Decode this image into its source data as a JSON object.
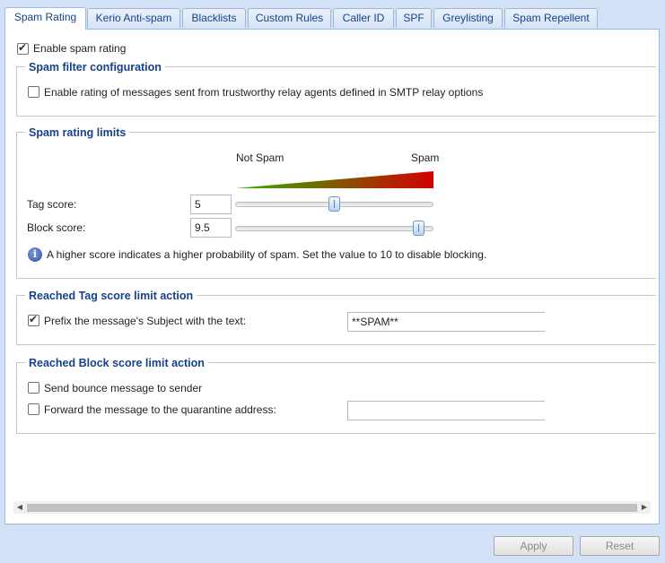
{
  "tabs": [
    {
      "label": "Spam Rating",
      "active": true
    },
    {
      "label": "Kerio Anti-spam"
    },
    {
      "label": "Blacklists"
    },
    {
      "label": "Custom Rules"
    },
    {
      "label": "Caller ID"
    },
    {
      "label": "SPF"
    },
    {
      "label": "Greylisting"
    },
    {
      "label": "Spam Repellent"
    }
  ],
  "enable": {
    "label": "Enable spam rating",
    "checked": true
  },
  "filter_config": {
    "legend": "Spam filter configuration",
    "trustworthy_label": "Enable rating of messages sent from trustworthy relay agents defined in SMTP relay options",
    "trustworthy_checked": false
  },
  "limits": {
    "legend": "Spam rating limits",
    "not_spam_label": "Not Spam",
    "spam_label": "Spam",
    "gradient_colors": [
      "#2db300",
      "#d40000"
    ],
    "tag_label": "Tag score:",
    "tag_value": "5",
    "block_label": "Block score:",
    "block_value": "9.5",
    "slider_max": 10,
    "info_text": "A higher score indicates a higher probability of spam. Set the value to 10 to disable blocking."
  },
  "tag_action": {
    "legend": "Reached Tag score limit action",
    "prefix_label": "Prefix the message's Subject with the text:",
    "prefix_checked": true,
    "prefix_value": "**SPAM**"
  },
  "block_action": {
    "legend": "Reached Block score limit action",
    "bounce_label": "Send bounce message to sender",
    "bounce_checked": false,
    "forward_label": "Forward the message to the quarantine address:",
    "forward_checked": false,
    "forward_value": ""
  },
  "buttons": {
    "apply": "Apply",
    "reset": "Reset"
  }
}
